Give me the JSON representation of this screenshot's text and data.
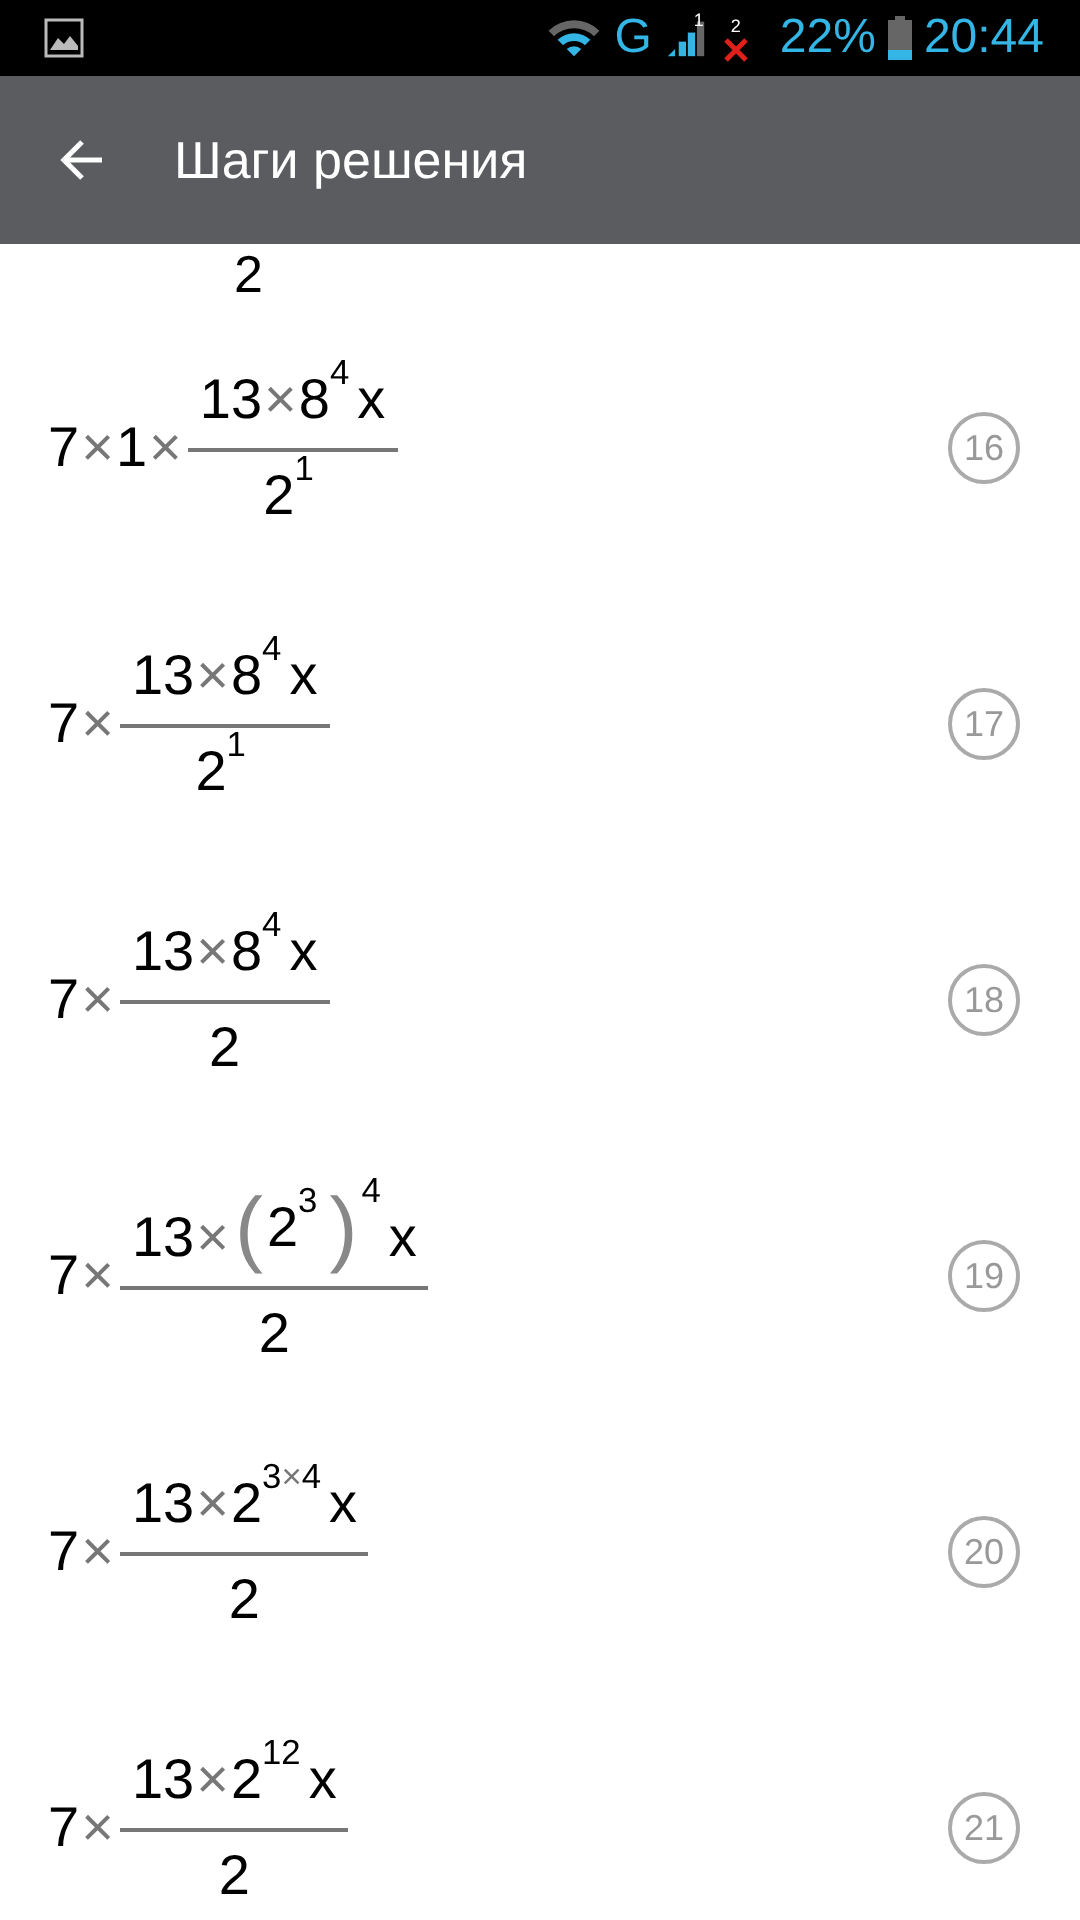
{
  "status_bar": {
    "network": "G",
    "sim1": "1",
    "sim2": "2",
    "battery": "22%",
    "time": "20:44"
  },
  "app_bar": {
    "title": "Шаги решения"
  },
  "partial_step": {
    "denominator": "2"
  },
  "steps": [
    {
      "number": "16",
      "prefix": [
        {
          "kind": "num",
          "text": "7"
        },
        {
          "kind": "op",
          "text": "×"
        },
        {
          "kind": "num",
          "text": "1"
        },
        {
          "kind": "op",
          "text": "×"
        }
      ],
      "numerator": [
        {
          "kind": "num",
          "text": "13"
        },
        {
          "kind": "op",
          "text": "×"
        },
        {
          "kind": "pow",
          "base": [
            {
              "kind": "num",
              "text": "8"
            }
          ],
          "exp": [
            {
              "kind": "num",
              "text": "4"
            }
          ]
        },
        {
          "kind": "num",
          "text": "x"
        }
      ],
      "denominator": [
        {
          "kind": "pow",
          "base": [
            {
              "kind": "num",
              "text": "2"
            }
          ],
          "exp": [
            {
              "kind": "num",
              "text": "1"
            }
          ]
        }
      ]
    },
    {
      "number": "17",
      "prefix": [
        {
          "kind": "num",
          "text": "7"
        },
        {
          "kind": "op",
          "text": "×"
        }
      ],
      "numerator": [
        {
          "kind": "num",
          "text": "13"
        },
        {
          "kind": "op",
          "text": "×"
        },
        {
          "kind": "pow",
          "base": [
            {
              "kind": "num",
              "text": "8"
            }
          ],
          "exp": [
            {
              "kind": "num",
              "text": "4"
            }
          ]
        },
        {
          "kind": "num",
          "text": "x"
        }
      ],
      "denominator": [
        {
          "kind": "pow",
          "base": [
            {
              "kind": "num",
              "text": "2"
            }
          ],
          "exp": [
            {
              "kind": "num",
              "text": "1"
            }
          ]
        }
      ]
    },
    {
      "number": "18",
      "prefix": [
        {
          "kind": "num",
          "text": "7"
        },
        {
          "kind": "op",
          "text": "×"
        }
      ],
      "numerator": [
        {
          "kind": "num",
          "text": "13"
        },
        {
          "kind": "op",
          "text": "×"
        },
        {
          "kind": "pow",
          "base": [
            {
              "kind": "num",
              "text": "8"
            }
          ],
          "exp": [
            {
              "kind": "num",
              "text": "4"
            }
          ]
        },
        {
          "kind": "num",
          "text": "x"
        }
      ],
      "denominator": [
        {
          "kind": "num",
          "text": "2"
        }
      ]
    },
    {
      "number": "19",
      "prefix": [
        {
          "kind": "num",
          "text": "7"
        },
        {
          "kind": "op",
          "text": "×"
        }
      ],
      "numerator": [
        {
          "kind": "num",
          "text": "13"
        },
        {
          "kind": "op",
          "text": "×"
        },
        {
          "kind": "pow",
          "base": [
            {
              "kind": "paren",
              "open": "(",
              "close": ")",
              "inner": [
                {
                  "kind": "pow",
                  "base": [
                    {
                      "kind": "num",
                      "text": "2"
                    }
                  ],
                  "exp": [
                    {
                      "kind": "num",
                      "text": "3"
                    }
                  ]
                }
              ]
            }
          ],
          "exp": [
            {
              "kind": "num",
              "text": "4"
            }
          ]
        },
        {
          "kind": "num",
          "text": "x"
        }
      ],
      "denominator": [
        {
          "kind": "num",
          "text": "2"
        }
      ]
    },
    {
      "number": "20",
      "prefix": [
        {
          "kind": "num",
          "text": "7"
        },
        {
          "kind": "op",
          "text": "×"
        }
      ],
      "numerator": [
        {
          "kind": "num",
          "text": "13"
        },
        {
          "kind": "op",
          "text": "×"
        },
        {
          "kind": "pow",
          "base": [
            {
              "kind": "num",
              "text": "2"
            }
          ],
          "exp": [
            {
              "kind": "num",
              "text": "3"
            },
            {
              "kind": "op",
              "text": "×"
            },
            {
              "kind": "num",
              "text": "4"
            }
          ]
        },
        {
          "kind": "num",
          "text": "x"
        }
      ],
      "denominator": [
        {
          "kind": "num",
          "text": "2"
        }
      ]
    },
    {
      "number": "21",
      "prefix": [
        {
          "kind": "num",
          "text": "7"
        },
        {
          "kind": "op",
          "text": "×"
        }
      ],
      "numerator": [
        {
          "kind": "num",
          "text": "13"
        },
        {
          "kind": "op",
          "text": "×"
        },
        {
          "kind": "pow",
          "base": [
            {
              "kind": "num",
              "text": "2"
            }
          ],
          "exp": [
            {
              "kind": "num",
              "text": "12"
            }
          ]
        },
        {
          "kind": "num",
          "text": "x"
        }
      ],
      "denominator": [
        {
          "kind": "num",
          "text": "2"
        }
      ]
    }
  ]
}
